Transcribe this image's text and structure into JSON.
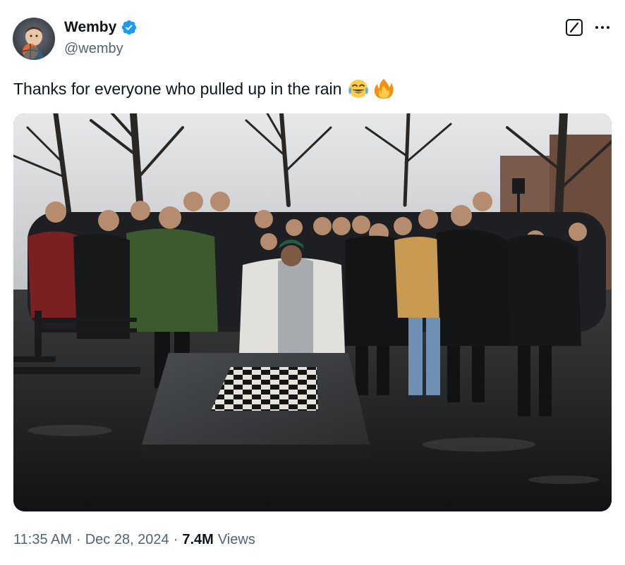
{
  "author": {
    "name": "Wemby",
    "handle": "@wemby",
    "verified": true,
    "verified_color": "#1d9bf0"
  },
  "tweet": {
    "text": "Thanks for everyone who pulled up in the rain",
    "emojis": [
      "face-with-tears-of-joy",
      "fire"
    ]
  },
  "media": {
    "type": "photo"
  },
  "meta": {
    "time": "11:35 AM",
    "separator": "·",
    "date": "Dec 28, 2024",
    "views_count": "7.4M",
    "views_label": "Views"
  },
  "icons": {
    "top_right": [
      "grok-icon",
      "more-icon"
    ]
  }
}
